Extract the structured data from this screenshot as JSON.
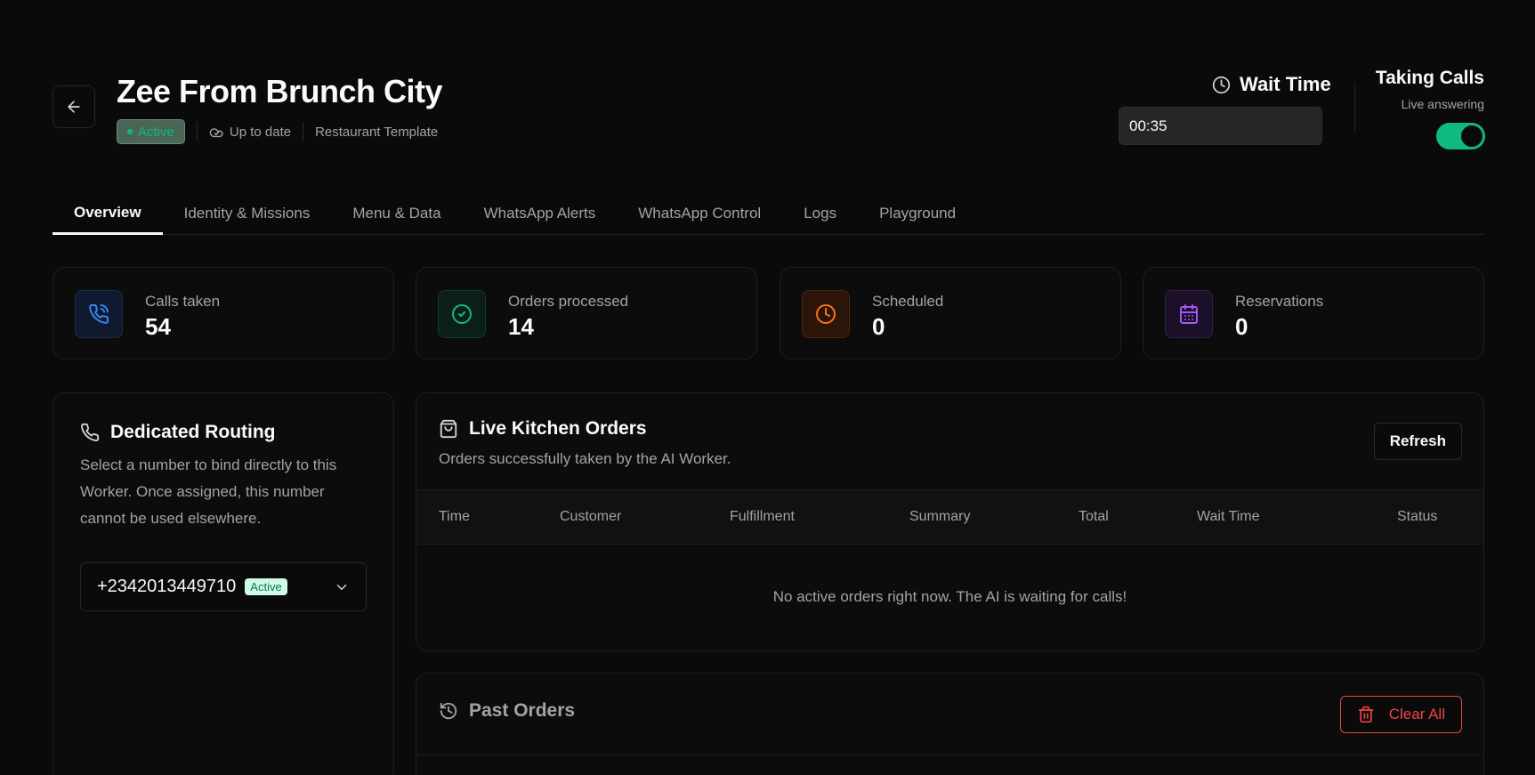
{
  "header": {
    "title": "Zee From Brunch City",
    "status": "Active",
    "sync": "Up to date",
    "template": "Restaurant Template"
  },
  "wait_time": {
    "label": "Wait Time",
    "value": "00:35"
  },
  "taking_calls": {
    "title": "Taking Calls",
    "subtitle": "Live answering",
    "enabled": true
  },
  "tabs": [
    {
      "label": "Overview",
      "active": true
    },
    {
      "label": "Identity & Missions"
    },
    {
      "label": "Menu & Data"
    },
    {
      "label": "WhatsApp Alerts"
    },
    {
      "label": "WhatsApp Control"
    },
    {
      "label": "Logs"
    },
    {
      "label": "Playground"
    }
  ],
  "stats": [
    {
      "label": "Calls taken",
      "value": "54",
      "icon": "phone-call-icon",
      "color": "#3b82f6"
    },
    {
      "label": "Orders processed",
      "value": "14",
      "icon": "check-circle-icon",
      "color": "#10b981"
    },
    {
      "label": "Scheduled",
      "value": "0",
      "icon": "clock-icon",
      "color": "#f97316"
    },
    {
      "label": "Reservations",
      "value": "0",
      "icon": "calendar-icon",
      "color": "#a855f7"
    }
  ],
  "routing": {
    "title": "Dedicated Routing",
    "description": "Select a number to bind directly to this Worker. Once assigned, this number cannot be used elsewhere.",
    "number": "+2342013449710",
    "number_status": "Active"
  },
  "live_orders": {
    "title": "Live Kitchen Orders",
    "subtitle": "Orders successfully taken by the AI Worker.",
    "refresh_label": "Refresh",
    "columns": [
      "Time",
      "Customer",
      "Fulfillment",
      "Summary",
      "Total",
      "Wait Time",
      "Status"
    ],
    "empty_message": "No active orders right now. The AI is waiting for calls!"
  },
  "past_orders": {
    "title": "Past Orders",
    "clear_label": "Clear All"
  },
  "colors": {
    "accent": "#10b981",
    "danger": "#ef4444",
    "background": "#0a0a0a"
  }
}
